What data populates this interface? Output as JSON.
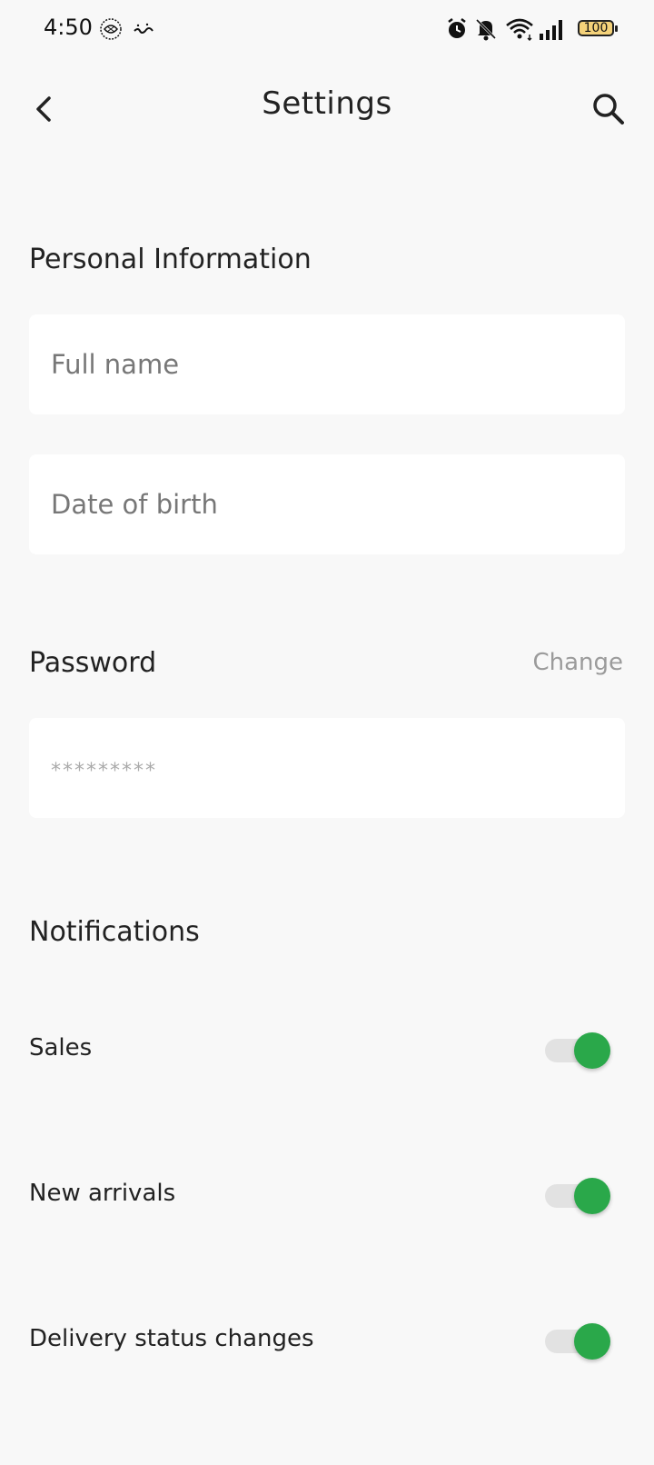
{
  "status_bar": {
    "time": "4:50",
    "battery": "100",
    "icons": [
      "calligraphy-logo-icon",
      "arabic-text-badge-icon",
      "alarm-icon",
      "notifications-off-icon",
      "wifi-icon",
      "signal-icon",
      "battery-icon"
    ]
  },
  "header": {
    "title": "Settings",
    "back_icon": "chevron-left-icon",
    "search_icon": "search-icon"
  },
  "personal": {
    "title": "Personal Information",
    "full_name_placeholder": "Full name",
    "dob_placeholder": "Date of birth"
  },
  "password": {
    "title": "Password",
    "change_label": "Change",
    "masked_value": "*********"
  },
  "notifications": {
    "title": "Notifications",
    "items": [
      {
        "label": "Sales",
        "enabled": true
      },
      {
        "label": "New arrivals",
        "enabled": true
      },
      {
        "label": "Delivery status changes",
        "enabled": true
      }
    ]
  },
  "colors": {
    "background": "#f8f8f8",
    "toggle_on": "#2aa84a",
    "muted_text": "#9b9b9b"
  }
}
